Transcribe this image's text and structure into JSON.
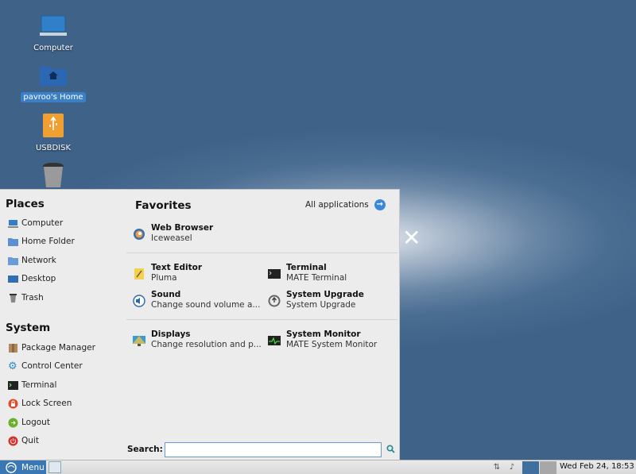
{
  "desktop": {
    "icons": [
      {
        "label": "Computer",
        "icon": "computer-icon"
      },
      {
        "label": "pavroo's Home",
        "icon": "home-folder-icon",
        "selected": true
      },
      {
        "label": "USBDISK",
        "icon": "usb-disk-icon"
      },
      {
        "label": "",
        "icon": "trash-icon"
      }
    ],
    "logo": "✕"
  },
  "menu": {
    "places": {
      "title": "Places",
      "items": [
        "Computer",
        "Home Folder",
        "Network",
        "Desktop",
        "Trash"
      ]
    },
    "system": {
      "title": "System",
      "items": [
        "Package Manager",
        "Control Center",
        "Terminal",
        "Lock Screen",
        "Logout",
        "Quit"
      ]
    },
    "favorites": {
      "title": "Favorites",
      "all_applications": "All applications",
      "apps": [
        {
          "name": "Web Browser",
          "desc": "Iceweasel",
          "icon": "web-browser-icon"
        },
        {
          "name": "Text Editor",
          "desc": "Pluma",
          "icon": "text-editor-icon"
        },
        {
          "name": "Terminal",
          "desc": "MATE Terminal",
          "icon": "terminal-icon"
        },
        {
          "name": "Sound",
          "desc": "Change sound volume a...",
          "icon": "sound-icon"
        },
        {
          "name": "System Upgrade",
          "desc": "System Upgrade",
          "icon": "system-upgrade-icon"
        },
        {
          "name": "Displays",
          "desc": "Change resolution and p...",
          "icon": "displays-icon"
        },
        {
          "name": "System Monitor",
          "desc": "MATE System Monitor",
          "icon": "system-monitor-icon"
        }
      ]
    },
    "search": {
      "label": "Search:",
      "value": ""
    }
  },
  "panel": {
    "menu_label": "Menu",
    "clock": "Wed Feb 24, 18:53"
  },
  "colors": {
    "accent": "#3b88d8",
    "panel_menu": "#3a77b5"
  }
}
